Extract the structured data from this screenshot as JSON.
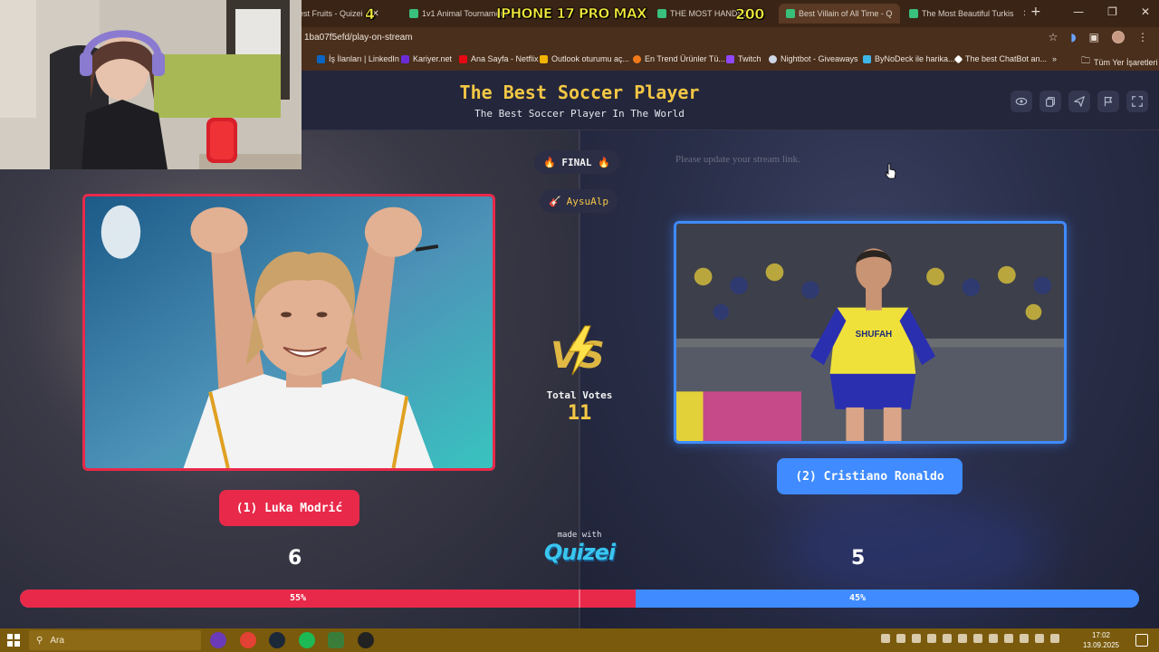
{
  "browser": {
    "tabs": [
      {
        "label": "est Fruits - Quizei"
      },
      {
        "label": "1v1 Animal Tournament"
      },
      {
        "label": "THE MOST HANDSO"
      },
      {
        "label": "Best Villain of All Time - Q"
      },
      {
        "label": "The Most Beautiful Turkis"
      }
    ],
    "overlay_texts": [
      "4",
      "IPHONE 17 PRO MAX",
      "200"
    ],
    "url": "1ba07f5efd/play-on-stream",
    "bookmarks": [
      {
        "label": "İş İlanları | LinkedIn",
        "color": "#0a66c2"
      },
      {
        "label": "Kariyer.net",
        "color": "#6b2bd9"
      },
      {
        "label": "Ana Sayfa - Netflix",
        "color": "#e50914"
      },
      {
        "label": "Outlook oturumu aç...",
        "color": "#f2b400"
      },
      {
        "label": "En Trend Ürünler Tü...",
        "color": "#f27a1a"
      },
      {
        "label": "Twitch",
        "color": "#9146ff"
      },
      {
        "label": "Nightbot - Giveaways",
        "color": "#cfd6e6"
      },
      {
        "label": "ByNoDeck ile harika...",
        "color": "#3fb6e8"
      },
      {
        "label": "The best ChatBot an...",
        "color": "#ffffff"
      }
    ],
    "bookmarks_more": "»",
    "all_bookmarks": "Tüm Yer İşaretleri"
  },
  "quiz": {
    "title": "The Best Soccer Player",
    "subtitle": "The Best Soccer Player In The World",
    "round_label": "🔥 FINAL 🔥",
    "user": "AysuAlp",
    "notice": "Please update your stream link.",
    "total_votes_label": "Total Votes",
    "total_votes": "11",
    "made_with": "made with",
    "logo_text": "Quizei",
    "left": {
      "name": "(1) Luka Modrić",
      "votes": "6",
      "percent": 55,
      "percent_label": "55%",
      "color": "#e8294a"
    },
    "right": {
      "name": "(2) Cristiano Ronaldo",
      "votes": "5",
      "percent": 45,
      "percent_label": "45%",
      "color": "#3f8bff"
    }
  },
  "taskbar": {
    "search_placeholder": "Ara",
    "time": "17:02",
    "date": "13.09.2025"
  }
}
